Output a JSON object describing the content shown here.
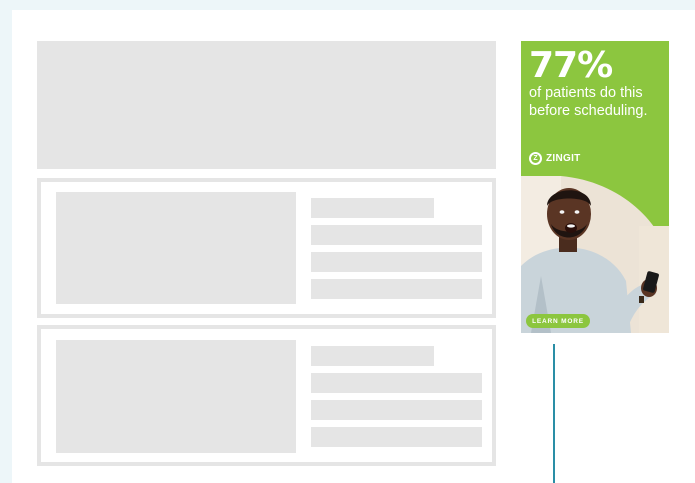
{
  "ad": {
    "headline": "77%",
    "subtext": "of patients do this before scheduling.",
    "brand": "ZINGIT",
    "cta_label": "LEARN MORE",
    "accent_color": "#8cc63f"
  },
  "colors": {
    "placeholder": "#e5e5e5",
    "page_background": "#edf6f9",
    "divider": "#2a8ea6"
  }
}
